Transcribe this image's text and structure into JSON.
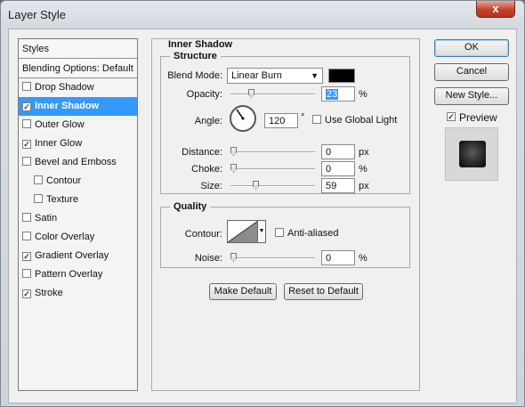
{
  "window": {
    "title": "Layer Style",
    "close_glyph": "x"
  },
  "styles_panel": {
    "header": "Styles",
    "blending_options": "Blending Options: Default",
    "items": [
      {
        "label": "Drop Shadow",
        "checked": false,
        "sub": false,
        "selected": false
      },
      {
        "label": "Inner Shadow",
        "checked": true,
        "sub": false,
        "selected": true
      },
      {
        "label": "Outer Glow",
        "checked": false,
        "sub": false,
        "selected": false
      },
      {
        "label": "Inner Glow",
        "checked": true,
        "sub": false,
        "selected": false
      },
      {
        "label": "Bevel and Emboss",
        "checked": false,
        "sub": false,
        "selected": false
      },
      {
        "label": "Contour",
        "checked": false,
        "sub": true,
        "selected": false
      },
      {
        "label": "Texture",
        "checked": false,
        "sub": true,
        "selected": false
      },
      {
        "label": "Satin",
        "checked": false,
        "sub": false,
        "selected": false
      },
      {
        "label": "Color Overlay",
        "checked": false,
        "sub": false,
        "selected": false
      },
      {
        "label": "Gradient Overlay",
        "checked": true,
        "sub": false,
        "selected": false
      },
      {
        "label": "Pattern Overlay",
        "checked": false,
        "sub": false,
        "selected": false
      },
      {
        "label": "Stroke",
        "checked": true,
        "sub": false,
        "selected": false
      }
    ]
  },
  "inner_shadow": {
    "title": "Inner Shadow",
    "structure": {
      "title": "Structure",
      "blend_mode_label": "Blend Mode:",
      "blend_mode_value": "Linear Burn",
      "shadow_color": "#000000",
      "opacity_label": "Opacity:",
      "opacity_value": "23",
      "opacity_unit": "%",
      "angle_label": "Angle:",
      "angle_value": "120",
      "angle_unit": "°",
      "use_global_light_label": "Use Global Light",
      "use_global_light": false,
      "distance_label": "Distance:",
      "distance_value": "0",
      "distance_unit": "px",
      "choke_label": "Choke:",
      "choke_value": "0",
      "choke_unit": "%",
      "size_label": "Size:",
      "size_value": "59",
      "size_unit": "px"
    },
    "quality": {
      "title": "Quality",
      "contour_label": "Contour:",
      "anti_aliased_label": "Anti-aliased",
      "anti_aliased": false,
      "noise_label": "Noise:",
      "noise_value": "0",
      "noise_unit": "%"
    },
    "make_default_label": "Make Default",
    "reset_default_label": "Reset to Default"
  },
  "side_buttons": {
    "ok_label": "OK",
    "cancel_label": "Cancel",
    "new_style_label": "New Style...",
    "preview_label": "Preview",
    "preview_checked": true
  },
  "check_glyph": "✓"
}
